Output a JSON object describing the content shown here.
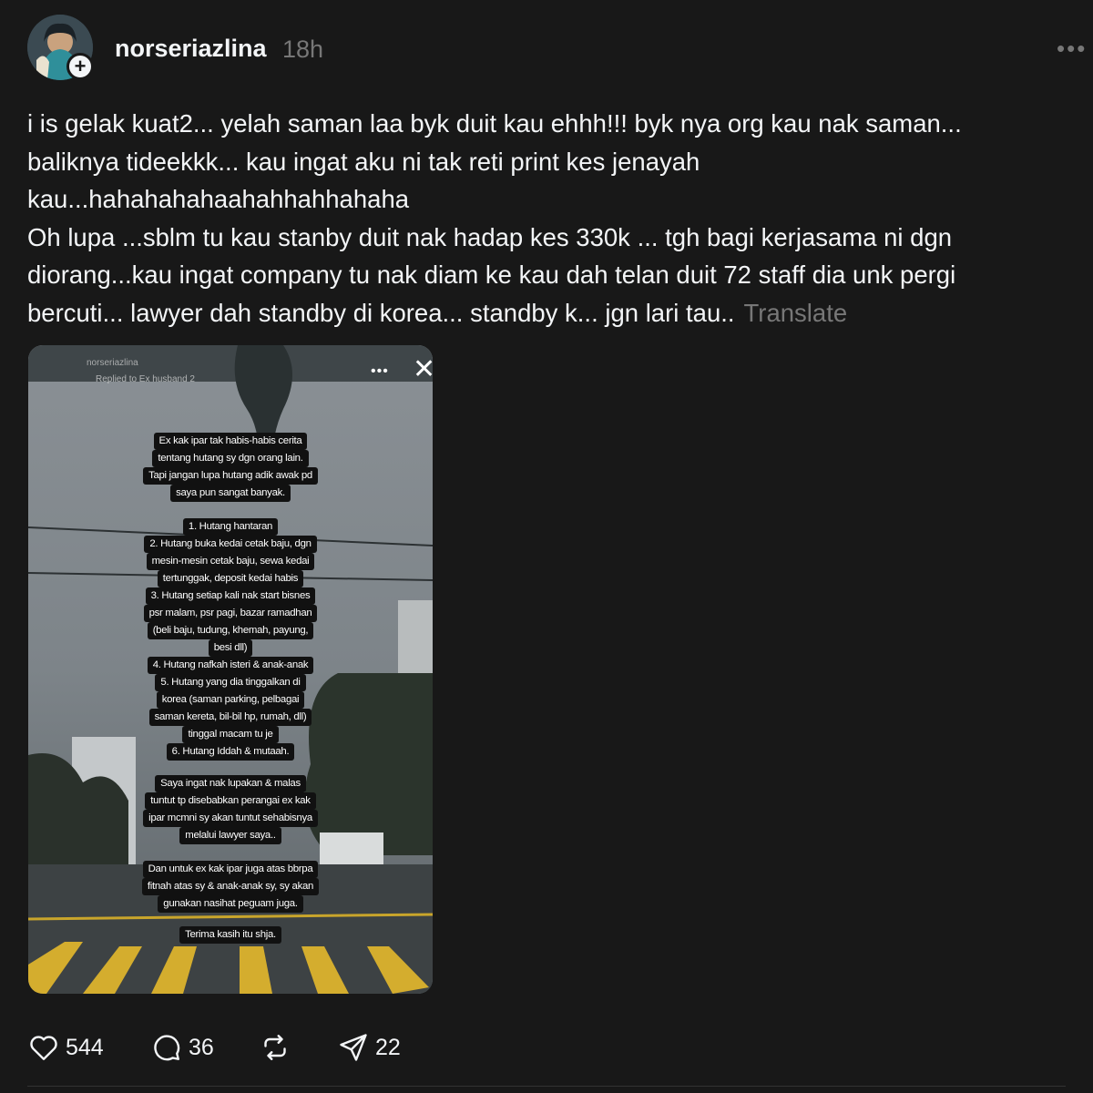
{
  "post": {
    "username": "norseriazlina",
    "timestamp": "18h",
    "text": "i is gelak kuat2... yelah saman laa byk duit kau ehhh!!! byk nya org kau nak saman...\nbaliknya tideekkk... kau ingat aku ni tak reti print kes jenayah\nkau...hahahahahaahahhahhahaha\nOh lupa ...sblm tu kau stanby duit nak hadap kes 330k ... tgh bagi kerjasama ni dgn\ndiorang...kau ingat company tu nak diam ke kau dah telan duit 72 staff dia unk pergi\nbercuti... lawyer dah standby di korea... standby k... jgn lari tau..",
    "translate_label": "Translate"
  },
  "story": {
    "header_user": "norseriazlina",
    "header_sub": "Replied to Ex husband 2",
    "close_glyph": "✕",
    "blocks": [
      [
        "Ex kak ipar tak habis-habis cerita",
        "tentang hutang sy dgn orang lain.",
        "Tapi jangan lupa hutang adik awak pd",
        "saya pun sangat banyak."
      ],
      [
        "1. Hutang hantaran",
        "2. Hutang buka kedai cetak baju, dgn",
        "mesin-mesin cetak baju, sewa kedai",
        "tertunggak, deposit kedai habis",
        "3. Hutang setiap kali nak start bisnes",
        "psr malam, psr pagi, bazar ramadhan",
        "(beli baju, tudung, khemah, payung,",
        "besi dll)",
        "4. Hutang nafkah isteri & anak-anak",
        "5. Hutang yang dia tinggalkan di",
        "korea (saman parking, pelbagai",
        "saman kereta, bil-bil hp, rumah, dll)",
        "tinggal macam tu je",
        "6. Hutang Iddah & mutaah."
      ],
      [
        "Saya ingat nak lupakan & malas",
        "tuntut tp disebabkan perangai ex kak",
        "ipar mcmni sy akan tuntut sehabisnya",
        "melalui lawyer saya.."
      ],
      [
        "Dan untuk ex kak ipar juga atas bbrpa",
        "fitnah atas sy & anak-anak sy, sy akan",
        "gunakan nasihat peguam juga."
      ],
      [
        "Terima kasih itu shja."
      ]
    ]
  },
  "actions": {
    "likes": "544",
    "comments": "36",
    "shares": "22"
  },
  "colors": {
    "background": "#181818",
    "text": "#f3f5f7",
    "muted": "#777777"
  }
}
